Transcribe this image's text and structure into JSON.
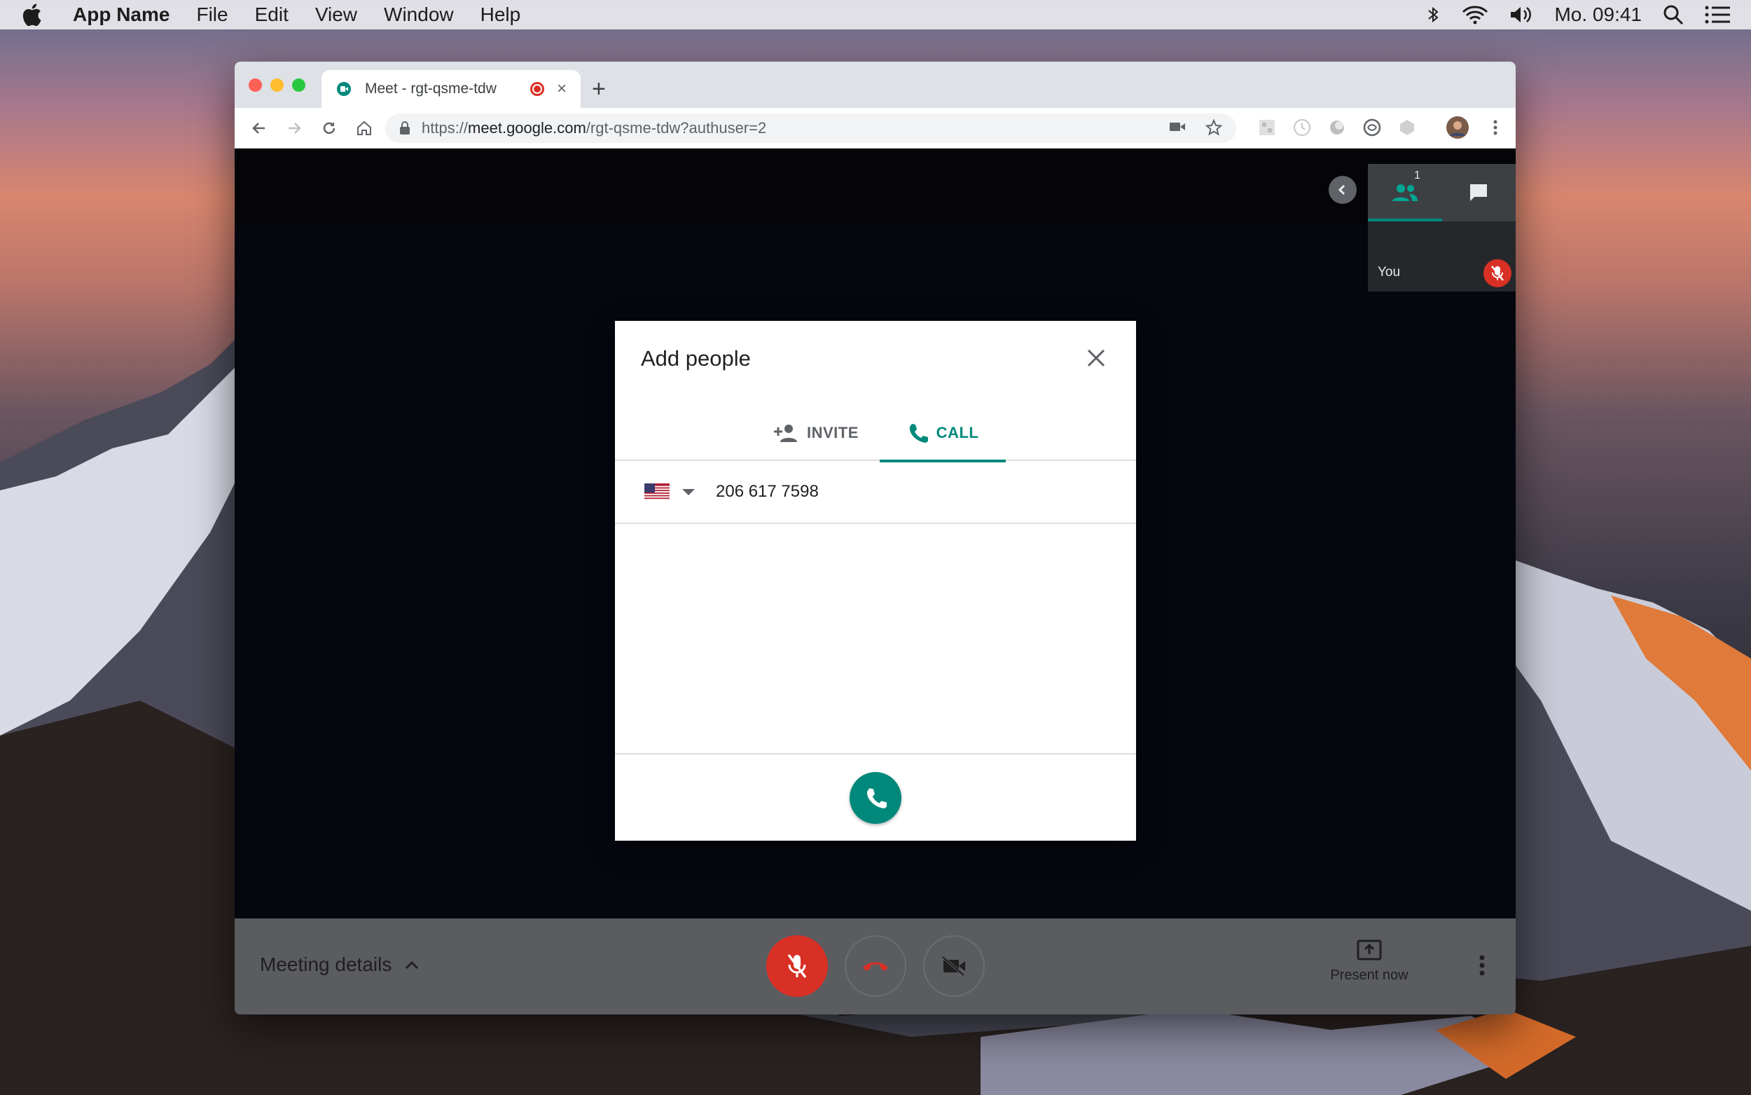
{
  "menubar": {
    "app_name": "App Name",
    "items": [
      "File",
      "Edit",
      "View",
      "Window",
      "Help"
    ],
    "clock": "Mo. 09:41"
  },
  "browser": {
    "tab_title": "Meet - rgt-qsme-tdw",
    "tab_close": "×",
    "new_tab": "+",
    "url_scheme": "https://",
    "url_host": "meet.google.com",
    "url_path": "/rgt-qsme-tdw?authuser=2"
  },
  "meet": {
    "participants_count": "1",
    "self_label": "You",
    "meeting_details_label": "Meeting details",
    "present_label": "Present now"
  },
  "dialog": {
    "title": "Add people",
    "tabs": [
      {
        "label": "INVITE",
        "active": false
      },
      {
        "label": "CALL",
        "active": true
      }
    ],
    "country": "US",
    "phone_value": "206 617 7598"
  },
  "colors": {
    "accent": "#00897b",
    "danger": "#d93025"
  }
}
